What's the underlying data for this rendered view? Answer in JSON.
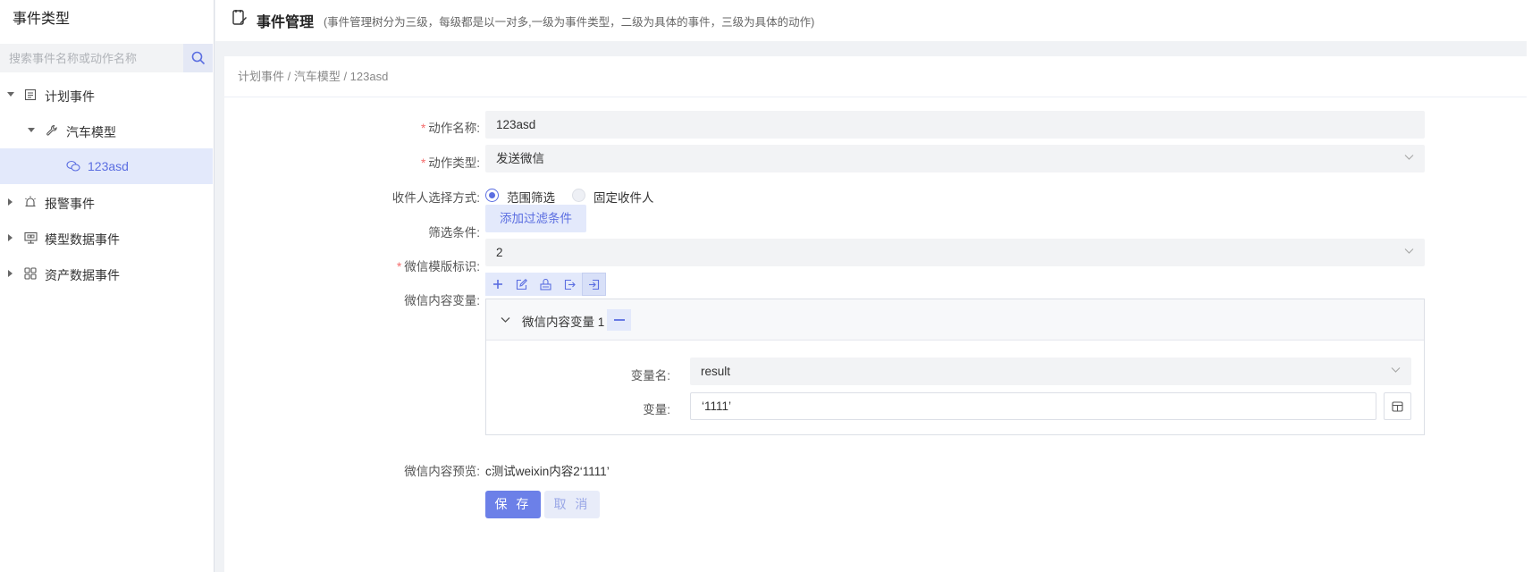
{
  "sidebar": {
    "title": "事件类型",
    "search_placeholder": "搜索事件名称或动作名称",
    "tree": [
      {
        "label": "计划事件",
        "icon": "plan-icon"
      },
      {
        "label": "汽车模型",
        "icon": "wrench-icon"
      },
      {
        "label": "123asd",
        "icon": "chat-icon"
      },
      {
        "label": "报警事件",
        "icon": "alarm-icon"
      },
      {
        "label": "模型数据事件",
        "icon": "monitor-icon"
      },
      {
        "label": "资产数据事件",
        "icon": "grid-icon"
      }
    ]
  },
  "header": {
    "title": "事件管理",
    "subtitle": "(事件管理树分为三级，每级都是以一对多,一级为事件类型，二级为具体的事件，三级为具体的动作)"
  },
  "breadcrumb": "计划事件 / 汽车模型 / 123asd",
  "form": {
    "action_name_label": "动作名称:",
    "action_name_value": "123asd",
    "action_type_label": "动作类型:",
    "action_type_value": "发送微信",
    "recipient_mode_label": "收件人选择方式:",
    "recipient_options": [
      "范围筛选",
      "固定收件人"
    ],
    "filter_label": "筛选条件:",
    "add_filter_button": "添加过滤条件",
    "template_id_label": "微信模版标识:",
    "template_id_value": "2",
    "content_vars_label": "微信内容变量:",
    "var_group_title": "微信内容变量 1",
    "var_name_label": "变量名:",
    "var_name_value": "result",
    "var_label": "变量:",
    "var_value": "‘1111’",
    "preview_label": "微信内容预览:",
    "preview_value": "c测试weixin内容2‘1111’",
    "save_button": "保 存",
    "cancel_button": "取 消"
  },
  "colors": {
    "accent": "#5b6ee1",
    "selected_bg": "#e3e9fb",
    "required": "#f56c6c"
  }
}
